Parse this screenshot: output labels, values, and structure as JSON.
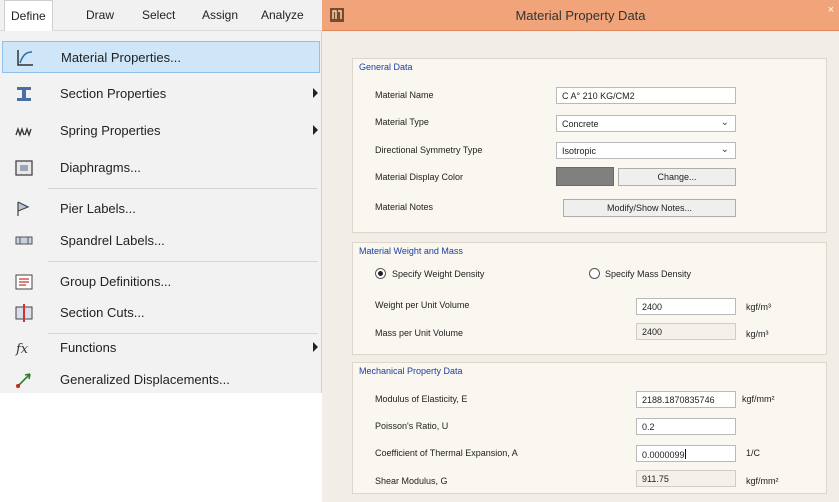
{
  "menubar": {
    "items": [
      "Define",
      "Draw",
      "Select",
      "Assign",
      "Analyze"
    ]
  },
  "dropdown": {
    "items": [
      {
        "label": "Material Properties...",
        "icon": "material-properties-icon",
        "highlighted": true
      },
      {
        "label": "Section Properties",
        "icon": "section-properties-icon",
        "submenu": true
      },
      {
        "label": "Spring Properties",
        "icon": "spring-properties-icon",
        "submenu": true
      },
      {
        "label": "Diaphragms...",
        "icon": "diaphragms-icon"
      },
      {
        "label": "Pier Labels...",
        "icon": "pier-labels-icon"
      },
      {
        "label": "Spandrel Labels...",
        "icon": "spandrel-labels-icon"
      },
      {
        "label": "Group Definitions...",
        "icon": "group-definitions-icon"
      },
      {
        "label": "Section Cuts...",
        "icon": "section-cuts-icon"
      },
      {
        "label": "Functions",
        "icon": "functions-icon",
        "submenu": true
      },
      {
        "label": "Generalized Displacements...",
        "icon": "generalized-displacements-icon"
      }
    ]
  },
  "dialog": {
    "title": "Material Property Data",
    "close_label": "×",
    "accent_color": "#f1a37a",
    "general": {
      "heading": "General Data",
      "name_label": "Material Name",
      "name_value": "C A° 210 KG/CM2",
      "type_label": "Material Type",
      "type_value": "Concrete",
      "symmetry_label": "Directional Symmetry Type",
      "symmetry_value": "Isotropic",
      "color_label": "Material Display Color",
      "display_color": "#808080",
      "change_label": "Change...",
      "notes_label": "Material Notes",
      "notes_button": "Modify/Show Notes..."
    },
    "weight": {
      "heading": "Material Weight and Mass",
      "option_weight": "Specify Weight Density",
      "option_mass": "Specify Mass Density",
      "selected": "weight",
      "wpuv_label": "Weight per Unit Volume",
      "wpuv_value": "2400",
      "wpuv_unit": "kgf/m³",
      "mpuv_label": "Mass per Unit Volume",
      "mpuv_value": "2400",
      "mpuv_unit": "kg/m³"
    },
    "mechanical": {
      "heading": "Mechanical Property Data",
      "e_label": "Modulus of Elasticity,  E",
      "e_value": "2188.1870835746",
      "e_unit": "kgf/mm²",
      "u_label": "Poisson's Ratio,  U",
      "u_value": "0.2",
      "a_label": "Coefficient of Thermal Expansion,  A",
      "a_value": "0.0000099",
      "a_unit": "1/C",
      "g_label": "Shear Modulus,  G",
      "g_value": "911.75",
      "g_unit": "kgf/mm²"
    }
  }
}
